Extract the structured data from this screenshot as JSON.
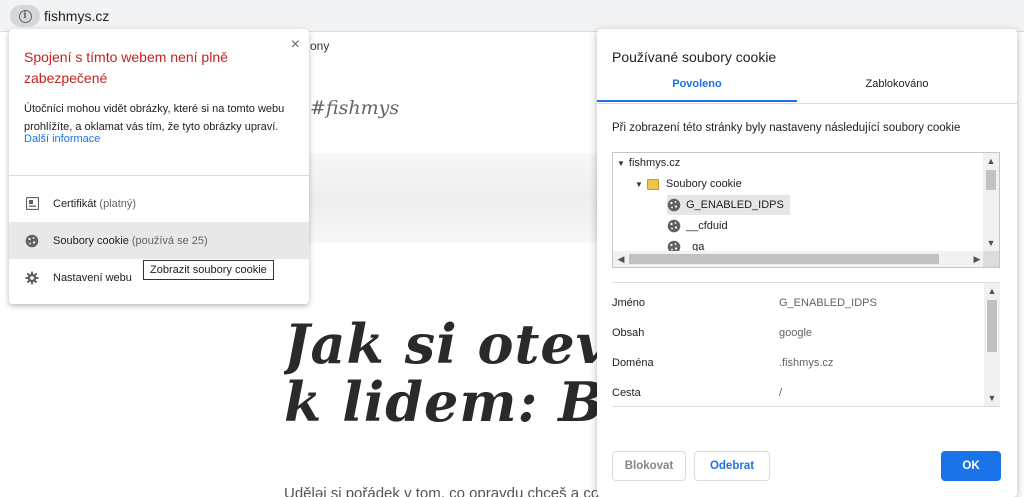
{
  "address_bar": {
    "url": "fishmys.cz"
  },
  "background_page": {
    "nav_fragment": "ony",
    "hashtag": "#fishmys",
    "headline_line1": "Jak si otevř",
    "headline_line2": "k lidem: Blo",
    "blurb": "Uděləj si pořádek v tom, co opravdu chceš a co ti brání"
  },
  "site_info_popup": {
    "close_label": "×",
    "title": "Spojení s tímto webem není plně zabezpečené",
    "description": "Útočníci mohou vidět obrázky, které si na tomto webu prohlížíte, a oklamat vás tím, že tyto obrázky upraví.",
    "learn_more": "Další informace",
    "rows": [
      {
        "label": "Certifikát",
        "sub": "(platný)",
        "icon": "certificate-icon"
      },
      {
        "label": "Soubory cookie",
        "sub": "(používá se 25)",
        "icon": "cookie-icon"
      },
      {
        "label": "Nastavení webu",
        "sub": "",
        "icon": "gear-icon"
      }
    ],
    "tooltip": "Zobrazit soubory cookie"
  },
  "cookie_dialog": {
    "title": "Používané soubory cookie",
    "tabs": [
      {
        "label": "Povoleno",
        "active": true
      },
      {
        "label": "Zablokováno",
        "active": false
      }
    ],
    "description": "Při zobrazení této stránky byly nastaveny následující soubory cookie",
    "tree": {
      "domain": "fishmys.cz",
      "folder": "Soubory cookie",
      "cookies": [
        "G_ENABLED_IDPS",
        "__cfduid",
        "_ga"
      ],
      "selected": "G_ENABLED_IDPS"
    },
    "details": [
      {
        "label": "Jméno",
        "value": "G_ENABLED_IDPS"
      },
      {
        "label": "Obsah",
        "value": "google"
      },
      {
        "label": "Doména",
        "value": ".fishmys.cz"
      },
      {
        "label": "Cesta",
        "value": "/"
      }
    ],
    "buttons": {
      "block": "Blokovat",
      "remove": "Odebrat",
      "ok": "OK"
    }
  },
  "colors": {
    "accent": "#1a73e8",
    "warning": "#c5221f"
  }
}
